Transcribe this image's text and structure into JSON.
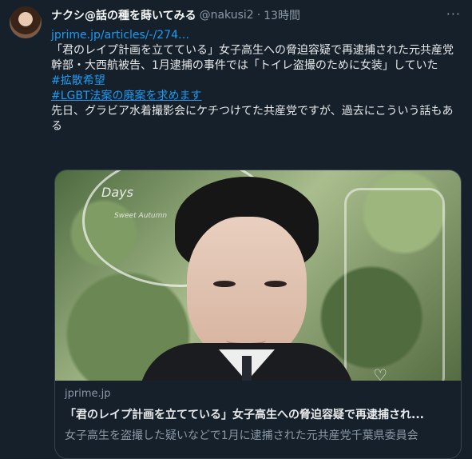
{
  "tweet": {
    "display_name": "ナクシ@話の種を蒔いてみる",
    "handle": "@nakusi2",
    "separator": "·",
    "time": "13時間",
    "more": "···",
    "url": "jprime.jp/articles/-/274…",
    "text_main": "「君のレイプ計画を立てている」女子高生への脅迫容疑で再逮捕された元共産党幹部・大西航被告、1月逮捕の事件では「トイレ盗撮のために女装」していた",
    "hashtag1": "#拡散希望",
    "hashtag2": "#LGBT法案の廃案を求めます",
    "text_tail": "先日、グラビア水着撮影会にケチつけてた共産党ですが、過去にこういう話もある"
  },
  "card": {
    "photo_text": "Days",
    "photo_sub": "Sweet Autumn",
    "domain": "jprime.jp",
    "title": "「君のレイプ計画を立てている」女子高生への脅迫容疑で再逮捕され...",
    "description": "女子高生を盗撮した疑いなどで1月に逮捕された元共産党千葉県委員会"
  }
}
